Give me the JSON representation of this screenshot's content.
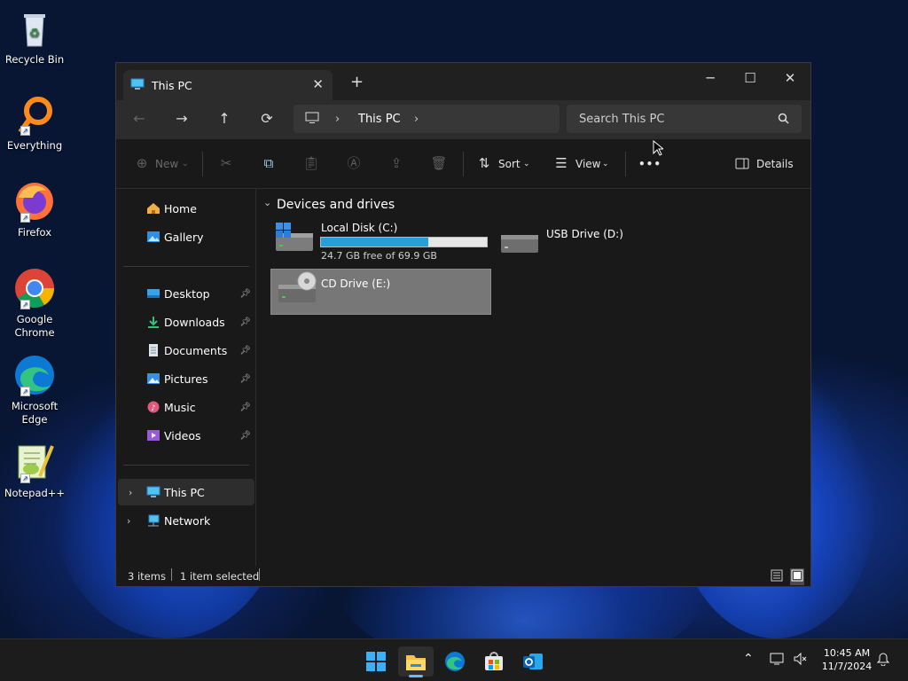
{
  "desktop": {
    "icons": [
      {
        "label": "Recycle Bin",
        "icon": "recycle-bin-icon"
      },
      {
        "label": "Everything",
        "icon": "everything-search-icon"
      },
      {
        "label": "Firefox",
        "icon": "firefox-icon"
      },
      {
        "label": "Google Chrome",
        "icon": "chrome-icon"
      },
      {
        "label": "Microsoft Edge",
        "icon": "edge-icon"
      },
      {
        "label": "Notepad++",
        "icon": "notepadpp-icon"
      }
    ]
  },
  "window": {
    "tab_title": "This PC",
    "tab_close": "✕",
    "new_tab": "+",
    "controls": {
      "minimize": "─",
      "maximize": "☐",
      "close": "✕"
    },
    "nav": {
      "back": "←",
      "forward": "→",
      "up": "↑",
      "refresh": "⟳"
    },
    "address": {
      "crumb": "This PC",
      "sep": "›"
    },
    "search_placeholder": "Search This PC",
    "toolbar": {
      "new": "New",
      "sort": "Sort",
      "view": "View",
      "more": "•••",
      "details": "Details"
    },
    "sidebar": {
      "top": [
        {
          "label": "Home",
          "icon": "home-icon"
        },
        {
          "label": "Gallery",
          "icon": "gallery-icon"
        }
      ],
      "pinned": [
        {
          "label": "Desktop",
          "icon": "desktop-folder-icon"
        },
        {
          "label": "Downloads",
          "icon": "downloads-icon"
        },
        {
          "label": "Documents",
          "icon": "documents-icon"
        },
        {
          "label": "Pictures",
          "icon": "pictures-icon"
        },
        {
          "label": "Music",
          "icon": "music-icon"
        },
        {
          "label": "Videos",
          "icon": "videos-icon"
        }
      ],
      "roots": [
        {
          "label": "This PC",
          "icon": "this-pc-icon",
          "selected": true
        },
        {
          "label": "Network",
          "icon": "network-icon"
        }
      ]
    },
    "content": {
      "section": "Devices and drives",
      "drives": [
        {
          "name": "Local Disk (C:)",
          "free_text": "24.7 GB free of 69.9 GB",
          "used_fraction": 0.647
        },
        {
          "name": "USB Drive (D:)"
        },
        {
          "name": "CD Drive (E:)",
          "selected": true
        }
      ]
    },
    "status": {
      "items": "3 items",
      "selected": "1 item selected"
    }
  },
  "taskbar": {
    "time": "10:45 AM",
    "date": "11/7/2024"
  },
  "colors": {
    "accent": "#0078d4",
    "progress": "#26a0da",
    "selection": "#777777"
  }
}
